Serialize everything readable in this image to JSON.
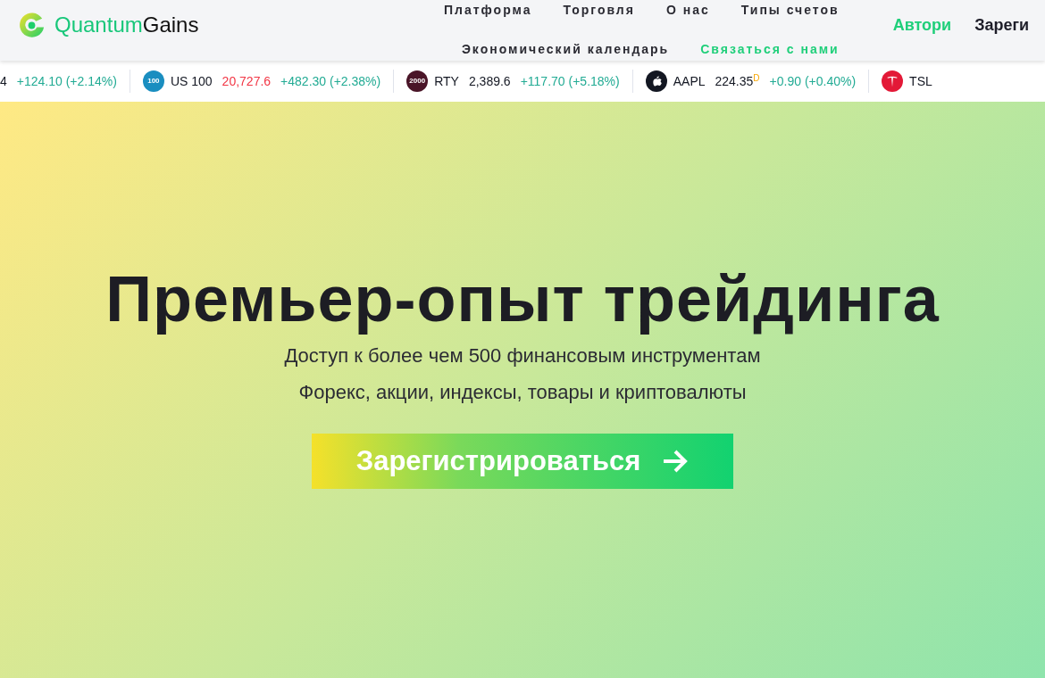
{
  "header": {
    "logo": {
      "first": "Quantum",
      "second": "Gains"
    },
    "nav_rows": [
      [
        {
          "label": "Платформа",
          "selected": false
        },
        {
          "label": "Торговля",
          "selected": false
        },
        {
          "label": "О нас",
          "selected": false
        },
        {
          "label": "Типы счетов",
          "selected": false
        }
      ],
      [
        {
          "label": "Экономический календарь",
          "selected": false
        },
        {
          "label": "Связаться с нами",
          "selected": true
        }
      ]
    ],
    "login": "Автори",
    "register": "Зареги"
  },
  "ticker": [
    {
      "kind": "partial",
      "price": "4",
      "falling": false,
      "change": "+124.10 (+2.14%)"
    },
    {
      "kind": "text-badge",
      "badge": "100",
      "color": "#1a8ec0",
      "symbol": "US 100",
      "price": "20,727.6",
      "falling": true,
      "change": "+482.30 (+2.38%)"
    },
    {
      "kind": "text-badge",
      "badge": "2000",
      "color": "#4a1528",
      "symbol": "RTY",
      "price": "2,389.6",
      "falling": false,
      "change": "+117.70 (+5.18%)"
    },
    {
      "kind": "apple",
      "color": "#131722",
      "symbol": "AAPL",
      "price": "224.35",
      "sup": "D",
      "falling": false,
      "change": "+0.90 (+0.40%)"
    },
    {
      "kind": "tesla",
      "color": "#e31937",
      "symbol": "TSL"
    }
  ],
  "hero": {
    "title": "Премьер-опыт трейдинга",
    "lines": [
      "Доступ к более чем 500 финансовым инструментам",
      "Форекс, акции, индексы, товары и криптовалюты"
    ],
    "cta": "Зарегистрироваться"
  }
}
